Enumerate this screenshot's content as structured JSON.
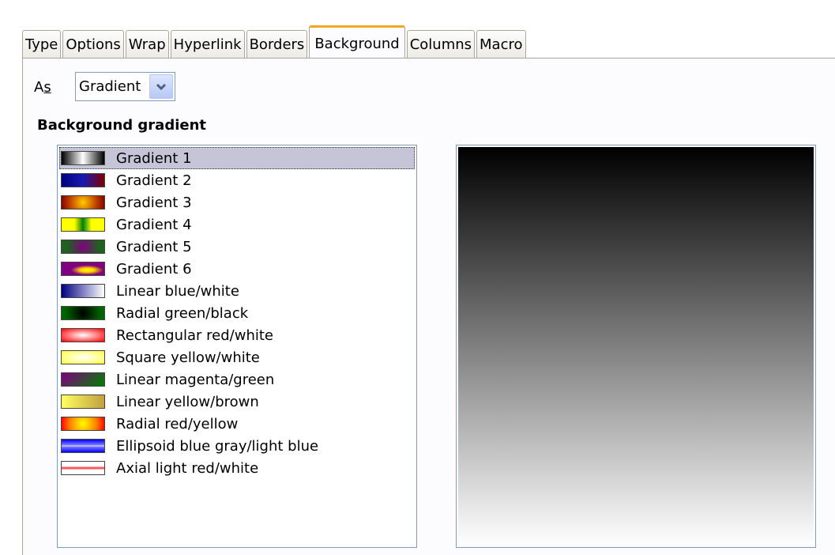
{
  "tabs": [
    {
      "label": "Type"
    },
    {
      "label": "Options"
    },
    {
      "label": "Wrap"
    },
    {
      "label": "Hyperlink"
    },
    {
      "label": "Borders"
    },
    {
      "label": "Background"
    },
    {
      "label": "Columns"
    },
    {
      "label": "Macro"
    }
  ],
  "active_tab": "Background",
  "as_label_prefix": "A",
  "as_label_accel": "s",
  "as_select": {
    "value": "Gradient"
  },
  "section_heading": "Background gradient",
  "gradients": [
    {
      "label": "Gradient 1",
      "selected": true,
      "swatch": "linear-gradient(90deg,#000 0%,#fff 50%,#000 100%)"
    },
    {
      "label": "Gradient 2",
      "swatch": "linear-gradient(90deg,#000080,#1a1ab0,#800000)"
    },
    {
      "label": "Gradient 3",
      "swatch": "radial-gradient(circle,#ffcc00 0%,#c04000 60%,#800000 100%)"
    },
    {
      "label": "Gradient 4",
      "swatch": "linear-gradient(90deg,#ffff00 0%,#ffff00 30%,#008000 50%,#ffff00 70%,#ffff00 100%)"
    },
    {
      "label": "Gradient 5",
      "swatch": "radial-gradient(circle,#800080 0%,#206020 70%)"
    },
    {
      "label": "Gradient 6",
      "swatch": "radial-gradient(ellipse at 60% 60%,#ffff00 0%,#ffcc00 20%,#800080 45%)"
    },
    {
      "label": "Linear blue/white",
      "swatch": "linear-gradient(90deg,#000080,#ffffff)"
    },
    {
      "label": "Radial green/black",
      "swatch": "radial-gradient(circle,#000 0%,#006400 80%)"
    },
    {
      "label": "Rectangular red/white",
      "swatch": "radial-gradient(ellipse,#ffffff 0%,#ff6060 60%,#ff0000 100%)"
    },
    {
      "label": "Square yellow/white",
      "swatch": "radial-gradient(ellipse,#ffffff 0%,#ffffa0 50%,#ffff40 100%)"
    },
    {
      "label": "Linear magenta/green",
      "swatch": "linear-gradient(135deg,#800080,#008000)"
    },
    {
      "label": "Linear yellow/brown",
      "swatch": "linear-gradient(90deg,#ffff60,#c0a040)"
    },
    {
      "label": "Radial red/yellow",
      "swatch": "radial-gradient(circle,#ffff00 0%,#ff8000 60%,#ff0000 100%)"
    },
    {
      "label": "Ellipsoid blue gray/light blue",
      "swatch": "linear-gradient(180deg,#0000ff 0%,#8080ff 45%,#ffffff 50%,#8080ff 55%,#0000ff 100%)"
    },
    {
      "label": "Axial light red/white",
      "swatch": "linear-gradient(180deg,#fff 0%,#fff 35%,#ff3030 50%,#fff 65%,#fff 100%)"
    }
  ],
  "preview": {
    "gradient": "linear-gradient(180deg,#000000,#ffffff)"
  }
}
